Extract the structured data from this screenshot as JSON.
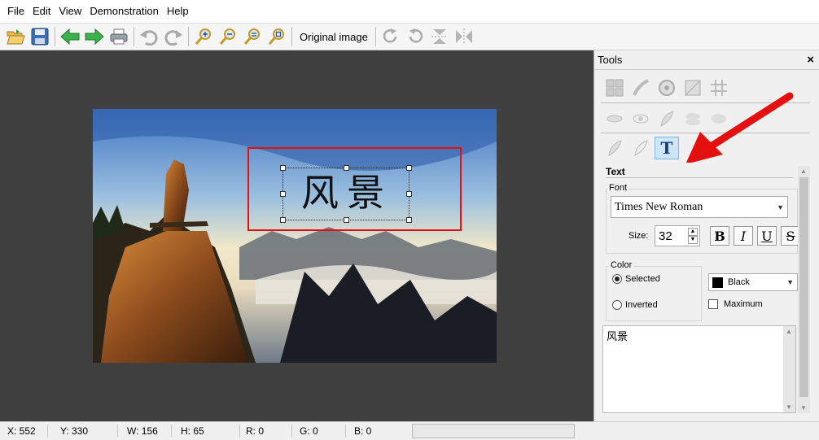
{
  "menu": [
    "File",
    "Edit",
    "View",
    "Demonstration",
    "Help"
  ],
  "toolbar": {
    "original_image_label": "Original image"
  },
  "canvas": {
    "overlay_text": "风景"
  },
  "tools_panel": {
    "title": "Tools",
    "close_glyph": "×",
    "text_section": {
      "title": "Text",
      "font_group_label": "Font",
      "font_value": "Times New Roman",
      "size_label": "Size:",
      "size_value": "32",
      "bold": "B",
      "italic": "I",
      "underline": "U",
      "strike": "S",
      "color_group_label": "Color",
      "radio_selected_label": "Selected",
      "radio_inverted_label": "Inverted",
      "color_value": "Black",
      "maximum_label": "Maximum",
      "text_content": "风景"
    }
  },
  "status": {
    "x": "X: 552",
    "y": "Y: 330",
    "w": "W: 156",
    "h": "H: 65",
    "r": "R: 0",
    "g": "G: 0",
    "b": "B: 0"
  },
  "colors": {
    "highlight_red": "#e41010",
    "canvas_bg": "#404040",
    "text_tool_active": "#cde6f7"
  }
}
